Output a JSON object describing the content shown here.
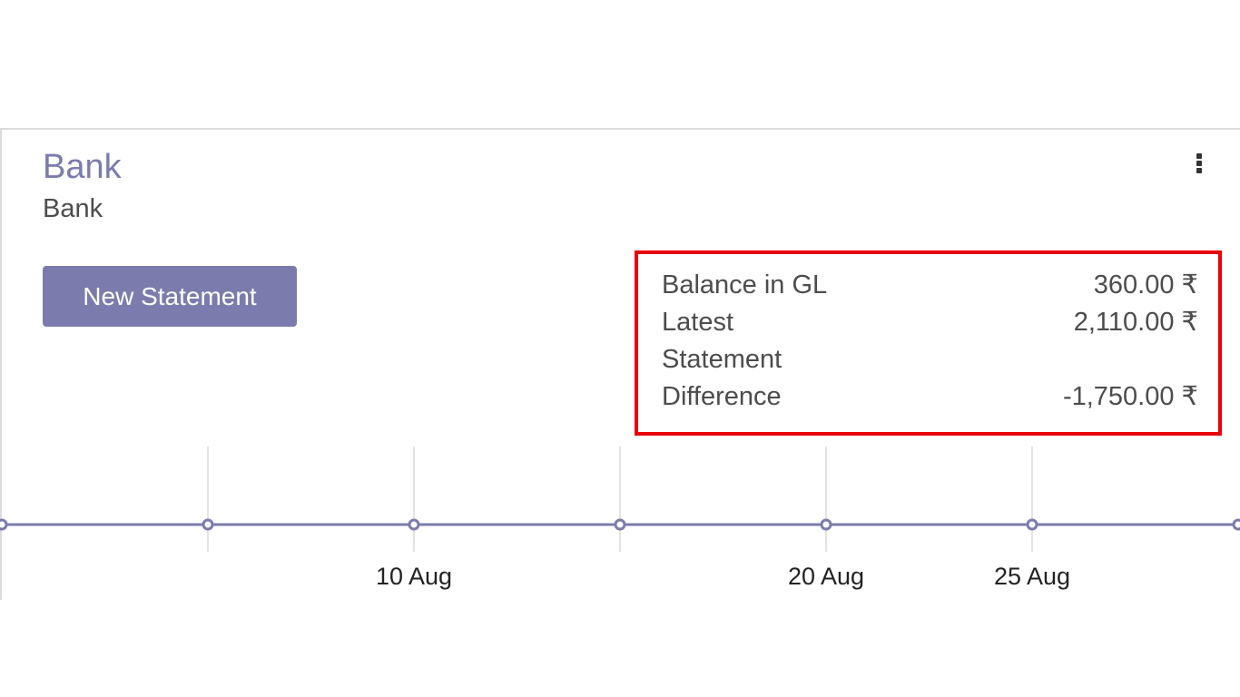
{
  "journal": {
    "title": "Bank",
    "subtitle": "Bank"
  },
  "actions": {
    "new_statement_label": "New Statement",
    "menu_icon": "vertical-ellipsis-icon"
  },
  "summary": {
    "balance_label": "Balance in GL",
    "balance_value": "360.00 ₹",
    "latest_label_line1": "Latest",
    "latest_label_line2": "Statement",
    "latest_value": "2,110.00 ₹",
    "difference_label": "Difference",
    "difference_value": "-1,750.00 ₹"
  },
  "colors": {
    "accent": "#7c7bad",
    "highlight_border": "#e8000b",
    "text": "#4c4c4c"
  },
  "chart_data": {
    "type": "line",
    "tick_labels": [
      "",
      "",
      "10 Aug",
      "",
      "20 Aug",
      "25 Aug",
      ""
    ],
    "points_visible": 7,
    "grid": true
  }
}
